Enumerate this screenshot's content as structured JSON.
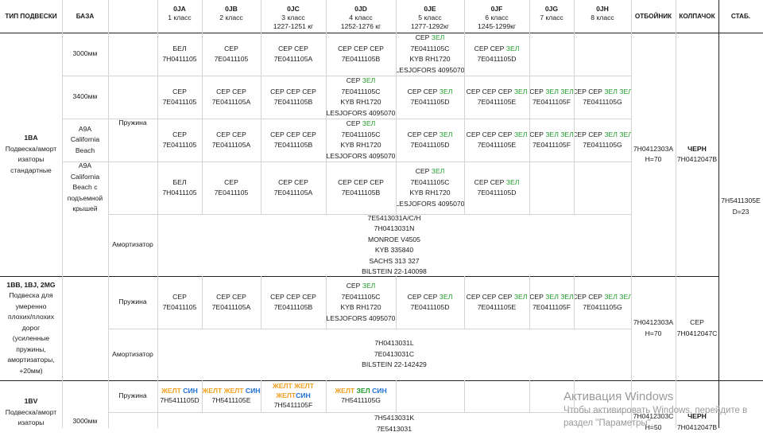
{
  "header": {
    "type": "ТИП ПОДВЕСКИ",
    "base": "БАЗА",
    "columns": [
      {
        "code": "0JA",
        "cls": "1 класс",
        "weight": ""
      },
      {
        "code": "0JB",
        "cls": "2 класс",
        "weight": ""
      },
      {
        "code": "0JC",
        "cls": "3 класс",
        "weight": "1227-1251 кг"
      },
      {
        "code": "0JD",
        "cls": "4 класс",
        "weight": "1252-1276 кг"
      },
      {
        "code": "0JE",
        "cls": "5 класс",
        "weight": "1277-1292кг"
      },
      {
        "code": "0JF",
        "cls": "6 класс",
        "weight": "1245-1299кг"
      },
      {
        "code": "0JG",
        "cls": "7 класс",
        "weight": ""
      },
      {
        "code": "0JH",
        "cls": "8 класс",
        "weight": ""
      }
    ],
    "bumper": "ОТБОЙНИК",
    "cap": "КОЛПАЧОК",
    "stab": "СТАБ."
  },
  "group1": {
    "type_title": "1BA",
    "type_desc": [
      "Подвеска/аморт",
      "изаторы",
      "стандартные"
    ],
    "bases": [
      [
        "3000мм"
      ],
      [
        "3400мм"
      ],
      [
        "A9A",
        "California",
        "Beach"
      ],
      [
        "A9A",
        "California",
        "Beach с",
        "подъемной",
        "крышей"
      ]
    ],
    "spring_label": "Пружина",
    "shock_label": "Амортизатор",
    "rows": [
      [
        [
          [
            "БЕЛ"
          ],
          [
            "7H0411105"
          ]
        ],
        [
          [
            "СЕР"
          ],
          [
            "7E0411105"
          ]
        ],
        [
          [
            "СЕР СЕР"
          ],
          [
            "7E0411105A"
          ]
        ],
        [
          [
            "СЕР СЕР СЕР"
          ],
          [
            "7E0411105B"
          ]
        ],
        [
          [
            "СЕР ",
            "ЗЕЛ"
          ],
          [
            "7E0411105C"
          ],
          [
            "KYB RH1720"
          ],
          [
            "LESJOFORS 4095070"
          ]
        ],
        [
          [
            "СЕР СЕР ",
            "ЗЕЛ"
          ],
          [
            "7E0411105D"
          ]
        ],
        [],
        []
      ],
      [
        [
          [
            "СЕР"
          ],
          [
            "7E0411105"
          ]
        ],
        [
          [
            "СЕР СЕР"
          ],
          [
            "7E0411105A"
          ]
        ],
        [
          [
            "СЕР СЕР СЕР"
          ],
          [
            "7E0411105B"
          ]
        ],
        [
          [
            "СЕР ",
            "ЗЕЛ"
          ],
          [
            "7E0411105C"
          ],
          [
            "KYB RH1720"
          ],
          [
            "LESJOFORS 4095070"
          ]
        ],
        [
          [
            "СЕР СЕР ",
            "ЗЕЛ"
          ],
          [
            "7E0411105D"
          ]
        ],
        [
          [
            "СЕР СЕР СЕР ",
            "ЗЕЛ"
          ],
          [
            "7E0411105E"
          ]
        ],
        [
          [
            "СЕР ",
            "ЗЕЛ ЗЕЛ"
          ],
          [
            "7E0411105F"
          ]
        ],
        [
          [
            "СЕР СЕР ",
            "ЗЕЛ ЗЕЛ"
          ],
          [
            "7E0411105G"
          ]
        ]
      ],
      [
        [
          [
            "СЕР"
          ],
          [
            "7E0411105"
          ]
        ],
        [
          [
            "СЕР СЕР"
          ],
          [
            "7E0411105A"
          ]
        ],
        [
          [
            "СЕР СЕР СЕР"
          ],
          [
            "7E0411105B"
          ]
        ],
        [
          [
            "СЕР ",
            "ЗЕЛ"
          ],
          [
            "7E0411105C"
          ],
          [
            "KYB RH1720"
          ],
          [
            "LESJOFORS 4095070"
          ]
        ],
        [
          [
            "СЕР СЕР ",
            "ЗЕЛ"
          ],
          [
            "7E0411105D"
          ]
        ],
        [
          [
            "СЕР СЕР СЕР ",
            "ЗЕЛ"
          ],
          [
            "7E0411105E"
          ]
        ],
        [
          [
            "СЕР ",
            "ЗЕЛ ЗЕЛ"
          ],
          [
            "7E0411105F"
          ]
        ],
        [
          [
            "СЕР СЕР ",
            "ЗЕЛ ЗЕЛ"
          ],
          [
            "7E0411105G"
          ]
        ]
      ],
      [
        [
          [
            "БЕЛ"
          ],
          [
            "7H0411105"
          ]
        ],
        [
          [
            "СЕР"
          ],
          [
            "7E0411105"
          ]
        ],
        [
          [
            "СЕР СЕР"
          ],
          [
            "7E0411105A"
          ]
        ],
        [
          [
            "СЕР СЕР СЕР"
          ],
          [
            "7E0411105B"
          ]
        ],
        [
          [
            "СЕР ",
            "ЗЕЛ"
          ],
          [
            "7E0411105C"
          ],
          [
            "KYB RH1720"
          ],
          [
            "LESJOFORS 4095070"
          ]
        ],
        [
          [
            "СЕР СЕР ",
            "ЗЕЛ"
          ],
          [
            "7E0411105D"
          ]
        ],
        [],
        []
      ]
    ],
    "shock": [
      "7E5413031A/C/H",
      "7H0413031N",
      "MONROE V4505",
      "KYB 335840",
      "SACHS 313 327",
      "BILSTEIN 22-140098"
    ],
    "bumper": [
      "7H0412303A",
      "H=70"
    ],
    "cap_color": "ЧЕРН",
    "cap_code": "7H0412047B",
    "stab": [
      "7H5411305E",
      "D=23"
    ]
  },
  "group2": {
    "type_title": "1BB, 1BJ, 2MG",
    "type_desc": [
      "Подвеска для",
      "умеренно",
      "плохих/плохих",
      "дорог",
      "(усиленные",
      "пружины,",
      "амортизаторы,",
      "+20мм)"
    ],
    "spring_label": "Пружина",
    "shock_label": "Амортизатор",
    "row": [
      [
        [
          "СЕР"
        ],
        [
          "7E0411105"
        ]
      ],
      [
        [
          "СЕР СЕР"
        ],
        [
          "7E0411105A"
        ]
      ],
      [
        [
          "СЕР СЕР СЕР"
        ],
        [
          "7E0411105B"
        ]
      ],
      [
        [
          "СЕР ",
          "ЗЕЛ"
        ],
        [
          "7E0411105C"
        ],
        [
          "KYB RH1720"
        ],
        [
          "LESJOFORS 4095070"
        ]
      ],
      [
        [
          "СЕР СЕР ",
          "ЗЕЛ"
        ],
        [
          "7E0411105D"
        ]
      ],
      [
        [
          "СЕР СЕР СЕР ",
          "ЗЕЛ"
        ],
        [
          "7E0411105E"
        ]
      ],
      [
        [
          "СЕР ",
          "ЗЕЛ ЗЕЛ"
        ],
        [
          "7E0411105F"
        ]
      ],
      [
        [
          "СЕР СЕР ",
          "ЗЕЛ ЗЕЛ"
        ],
        [
          "7E0411105G"
        ]
      ]
    ],
    "shock": [
      "7H0413031L",
      "7E0413031C",
      "BILSTEIN 22-142429"
    ],
    "bumper": [
      "7H0412303A",
      "H=70"
    ],
    "cap": [
      "СЕР",
      "7H0412047C"
    ]
  },
  "group3": {
    "type_title": "1BV",
    "type_desc": [
      "Подвеска/аморт",
      "изаторы"
    ],
    "base": "3000мм",
    "spring_label": "Пружина",
    "springs": [
      {
        "color": [
          "ЖЕЛТ ",
          "СИН"
        ],
        "code": "7H5411105D"
      },
      {
        "color": [
          "ЖЕЛТ ЖЕЛТ ",
          "СИН"
        ],
        "code": "7H5411105E"
      },
      {
        "color": [
          "ЖЕЛТ ЖЕЛТ  ЖЕЛТ",
          "СИН"
        ],
        "code": "7H5411105F"
      },
      {
        "color": [
          "ЖЕЛТ ",
          "ЗЕЛ ",
          "СИН"
        ],
        "code": "7H5411105G"
      }
    ],
    "shock": [
      "7H5413031K",
      "7E5413031"
    ],
    "bumper": [
      "7H0412303C",
      "H=50"
    ],
    "cap_color": "ЧЕРН",
    "cap_code": "7H0412047B"
  },
  "watermark": {
    "title": "Активация Windows",
    "line1": "Чтобы активировать Windows, перейдите в",
    "line2": "раздел \"Параметры\"."
  }
}
